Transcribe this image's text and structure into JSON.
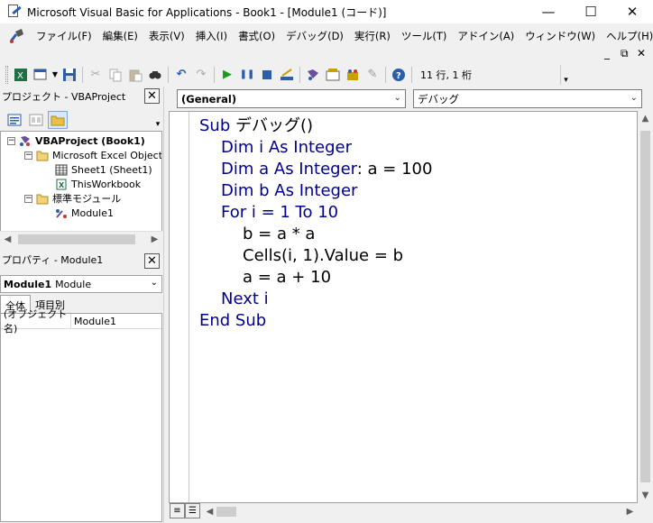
{
  "window": {
    "title": "Microsoft Visual Basic for Applications - Book1 - [Module1 (コード)]",
    "minimize": "—",
    "maximize": "☐",
    "close": "✕"
  },
  "menu": {
    "items": [
      "ファイル(F)",
      "編集(E)",
      "表示(V)",
      "挿入(I)",
      "書式(O)",
      "デバッグ(D)",
      "実行(R)",
      "ツール(T)",
      "アドイン(A)",
      "ウィンドウ(W)",
      "ヘルプ(H)"
    ],
    "mdi_minimize": "_",
    "mdi_restore": "⧉",
    "mdi_close": "✕"
  },
  "toolbar": {
    "cursor_position": "11 行, 1 桁"
  },
  "project_pane": {
    "title": "プロジェクト - VBAProject",
    "tree": [
      {
        "label": "VBAProject (Book1)",
        "icon": "vbaproject-icon"
      },
      {
        "label": "Microsoft Excel Objects",
        "icon": "folder-icon"
      },
      {
        "label": "Sheet1 (Sheet1)",
        "icon": "sheet-icon"
      },
      {
        "label": "ThisWorkbook",
        "icon": "workbook-icon"
      },
      {
        "label": "標準モジュール",
        "icon": "folder-icon"
      },
      {
        "label": "Module1",
        "icon": "module-icon"
      }
    ]
  },
  "properties_pane": {
    "title": "プロパティ - Module1",
    "object_name": "Module1",
    "object_type": "Module",
    "tabs": [
      "全体",
      "項目別"
    ],
    "rows": [
      {
        "key": "(オブジェクト名)",
        "value": "Module1"
      }
    ]
  },
  "code_window": {
    "object_combo": "(General)",
    "procedure_combo": "デバッグ",
    "lines": [
      {
        "kw": "Sub",
        "rest": " デバッグ()"
      },
      {
        "kw": "Dim",
        "rest": " i ",
        "kw2": "As Integer",
        "rest2": ""
      },
      {
        "kw": "Dim",
        "rest": " a ",
        "kw2": "As Integer",
        "rest2": ": a = 100"
      },
      {
        "kw": "Dim",
        "rest": " b ",
        "kw2": "As Integer",
        "rest2": ""
      },
      {
        "kw": "For",
        "rest": " i = 1 ",
        "kw2": "To",
        "rest2": " 10"
      },
      {
        "kw": "",
        "rest": "b = a * a"
      },
      {
        "kw": "",
        "rest": "Cells(i, 1).Value = b"
      },
      {
        "kw": "",
        "rest": "a = a + 10"
      },
      {
        "kw": "Next",
        "rest": " i"
      },
      {
        "kw": "End Sub",
        "rest": ""
      }
    ]
  },
  "colors": {
    "keyword": "#00008b",
    "background": "#f0f0f0",
    "code_background": "#ffffff"
  }
}
